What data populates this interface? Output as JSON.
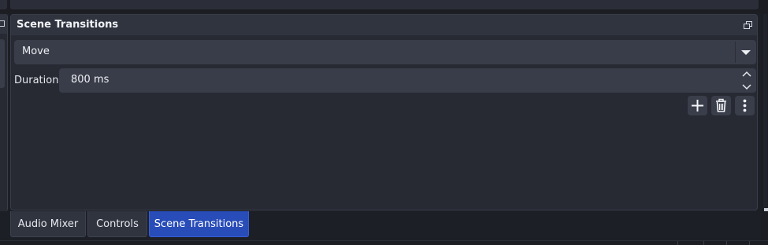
{
  "dock": {
    "title": "Scene Transitions",
    "float_icon": "float-window-icon"
  },
  "transition": {
    "selected": "Move",
    "dropdown_icon": "chevron-down-icon"
  },
  "duration": {
    "label": "Duration",
    "value": "800 ms",
    "up_icon": "chevron-up-icon",
    "down_icon": "chevron-down-icon"
  },
  "actions": {
    "add_icon": "plus-icon",
    "remove_icon": "trash-icon",
    "more_icon": "more-vertical-icon"
  },
  "tabs": [
    {
      "label": "Audio Mixer",
      "active": false
    },
    {
      "label": "Controls",
      "active": false
    },
    {
      "label": "Scene Transitions",
      "active": true
    }
  ],
  "colors": {
    "background": "#1d1f26",
    "panel": "#272a33",
    "header": "#30343f",
    "field": "#393d49",
    "accent": "#284cb8",
    "text": "#e6e8ee"
  }
}
